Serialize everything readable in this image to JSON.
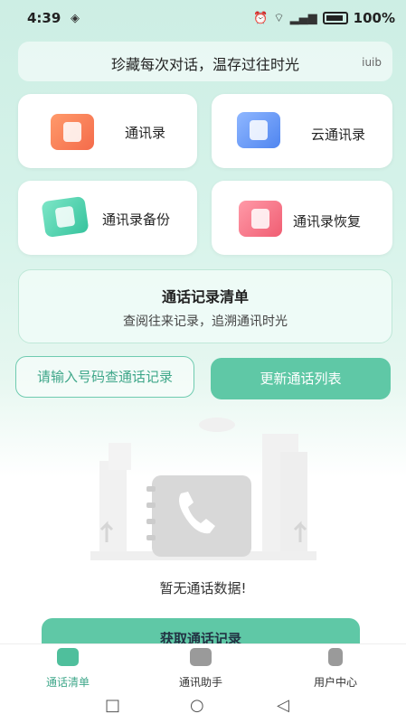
{
  "status": {
    "time": "4:39",
    "battery": "100%"
  },
  "slogan": {
    "text": "珍藏每次对话，温存过往时光",
    "tag": "iuib"
  },
  "cards": {
    "contacts": "通讯录",
    "cloud_contacts": "云通讯录",
    "backup": "通讯录备份",
    "restore": "通讯录恢复"
  },
  "banner": {
    "title": "通话记录清单",
    "subtitle": "查阅往来记录，追溯通讯时光"
  },
  "search_button": "请输入号码查通话记录",
  "update_button": "更新通话列表",
  "empty_text": "暂无通话数据!",
  "fetch_button": "获取通话记录",
  "tabs": [
    "通话清单",
    "通讯助手",
    "用户中心"
  ],
  "colors": {
    "accent": "#5fc8a6",
    "accent_text": "#3fa78a"
  }
}
